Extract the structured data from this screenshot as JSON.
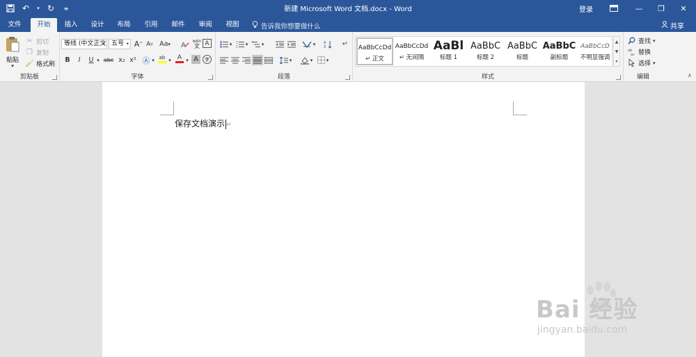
{
  "titlebar": {
    "title": "新建 Microsoft Word 文档.docx  -  Word",
    "login": "登录",
    "bg_color": "#2b579a"
  },
  "tabs": [
    {
      "label": "文件",
      "active": false
    },
    {
      "label": "开始",
      "active": true
    },
    {
      "label": "插入",
      "active": false
    },
    {
      "label": "设计",
      "active": false
    },
    {
      "label": "布局",
      "active": false
    },
    {
      "label": "引用",
      "active": false
    },
    {
      "label": "邮件",
      "active": false
    },
    {
      "label": "审阅",
      "active": false
    },
    {
      "label": "视图",
      "active": false
    }
  ],
  "tellme": "告诉我你想要做什么",
  "share": "共享",
  "clipboard": {
    "label": "剪贴板",
    "paste": "粘贴",
    "cut": "剪切",
    "copy": "复制",
    "format_painter": "格式刷"
  },
  "font": {
    "label": "字体",
    "family": "等线 (中文正文",
    "size": "五号",
    "grow": "A",
    "shrink": "A",
    "case": "Aa",
    "bold": "B",
    "italic": "I",
    "underline": "U",
    "strike": "abc",
    "subscript": "x₂",
    "superscript": "x²",
    "pinyin": "wén",
    "border_char": "A",
    "shade_char": "A",
    "encircle": "字",
    "highlight": "ab",
    "font_color": "A"
  },
  "paragraph": {
    "label": "段落"
  },
  "styles": {
    "label": "样式",
    "items": [
      {
        "preview": "AaBbCcDd",
        "name": "↵ 正文",
        "selected": true
      },
      {
        "preview": "AaBbCcDd",
        "name": "↵ 无间隔",
        "selected": false
      },
      {
        "preview": "AaBl",
        "name": "标题 1",
        "selected": false
      },
      {
        "preview": "AaBbC",
        "name": "标题 2",
        "selected": false
      },
      {
        "preview": "AaBbC",
        "name": "标题",
        "selected": false
      },
      {
        "preview": "AaBbC",
        "name": "副标题",
        "selected": false
      },
      {
        "preview": "AaBbCcD",
        "name": "不明显强调",
        "selected": false
      }
    ]
  },
  "editing": {
    "label": "编辑",
    "find": "查找",
    "replace": "替换",
    "select": "选择"
  },
  "document": {
    "text": "保存文档演示",
    "paragraph_mark": "↵"
  },
  "watermark": {
    "main": "Bai 经验",
    "sub": "jingyan.baidu.com"
  }
}
